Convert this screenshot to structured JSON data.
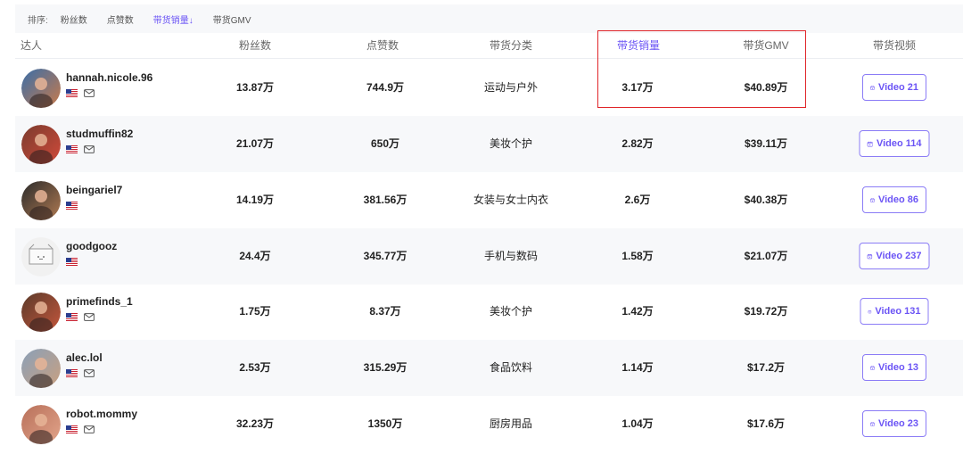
{
  "sortbar": {
    "label": "排序:",
    "options": [
      "粉丝数",
      "点赞数",
      "带货销量↓",
      "带货GMV"
    ],
    "active_index": 2
  },
  "table": {
    "headers": {
      "name": "达人",
      "fans": "粉丝数",
      "likes": "点赞数",
      "category": "带货分类",
      "sales": "带货销量",
      "gmv": "带货GMV",
      "videos": "带货视频"
    },
    "rows": [
      {
        "username": "hannah.nicole.96",
        "has_mail": true,
        "fans": "13.87万",
        "likes": "744.9万",
        "category": "运动与户外",
        "sales": "3.17万",
        "gmv": "$40.89万",
        "video": "Video 21"
      },
      {
        "username": "studmuffin82",
        "has_mail": true,
        "fans": "21.07万",
        "likes": "650万",
        "category": "美妆个护",
        "sales": "2.82万",
        "gmv": "$39.11万",
        "video": "Video 114"
      },
      {
        "username": "beingariel7",
        "has_mail": false,
        "fans": "14.19万",
        "likes": "381.56万",
        "category": "女装与女士内衣",
        "sales": "2.6万",
        "gmv": "$40.38万",
        "video": "Video 86"
      },
      {
        "username": "goodgooz",
        "has_mail": false,
        "fans": "24.4万",
        "likes": "345.77万",
        "category": "手机与数码",
        "sales": "1.58万",
        "gmv": "$21.07万",
        "video": "Video 237"
      },
      {
        "username": "primefinds_1",
        "has_mail": true,
        "fans": "1.75万",
        "likes": "8.37万",
        "category": "美妆个护",
        "sales": "1.42万",
        "gmv": "$19.72万",
        "video": "Video 131"
      },
      {
        "username": "alec.lol",
        "has_mail": true,
        "fans": "2.53万",
        "likes": "315.29万",
        "category": "食品饮料",
        "sales": "1.14万",
        "gmv": "$17.2万",
        "video": "Video 13"
      },
      {
        "username": "robot.mommy",
        "has_mail": true,
        "fans": "32.23万",
        "likes": "1350万",
        "category": "厨房用品",
        "sales": "1.04万",
        "gmv": "$17.6万",
        "video": "Video 23"
      }
    ]
  },
  "colors": {
    "accent": "#6b54f5",
    "highlight": "#e0262a",
    "row_alt": "#f7f8fa"
  },
  "icons": {
    "flag": "us-flag-icon",
    "mail": "mail-icon",
    "video": "calendar-video-icon"
  }
}
